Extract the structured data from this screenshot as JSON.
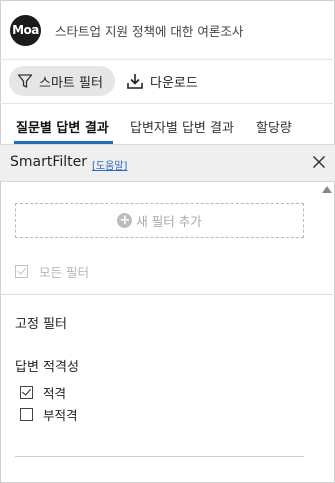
{
  "app": {
    "logo_text": "Moa",
    "title": "스타트업 지원 정책에 대한 여론조사"
  },
  "toolbar": {
    "smart_filter_label": "스마트 필터",
    "download_label": "다운로드"
  },
  "tabs": [
    {
      "label": "질문별 답변 결과",
      "active": true
    },
    {
      "label": "답변자별 답변 결과",
      "active": false
    },
    {
      "label": "할당량",
      "active": false
    }
  ],
  "smart_filter": {
    "title": "SmartFilter",
    "help_link": "[도움말]",
    "add_filter_label": "새 필터 추가",
    "all_filters": {
      "label": "모든 필터",
      "checked": true,
      "disabled": true
    },
    "fixed_filters_title": "고정 필터",
    "groups": [
      {
        "title": "답변 적격성",
        "options": [
          {
            "label": "적격",
            "checked": true
          },
          {
            "label": "부적격",
            "checked": false
          }
        ]
      }
    ]
  },
  "colors": {
    "accent": "#1f6fb5",
    "logo_bg": "#1b1b1b",
    "panel_header_bg": "#efefef",
    "pill_bg": "#e6e6e6"
  }
}
